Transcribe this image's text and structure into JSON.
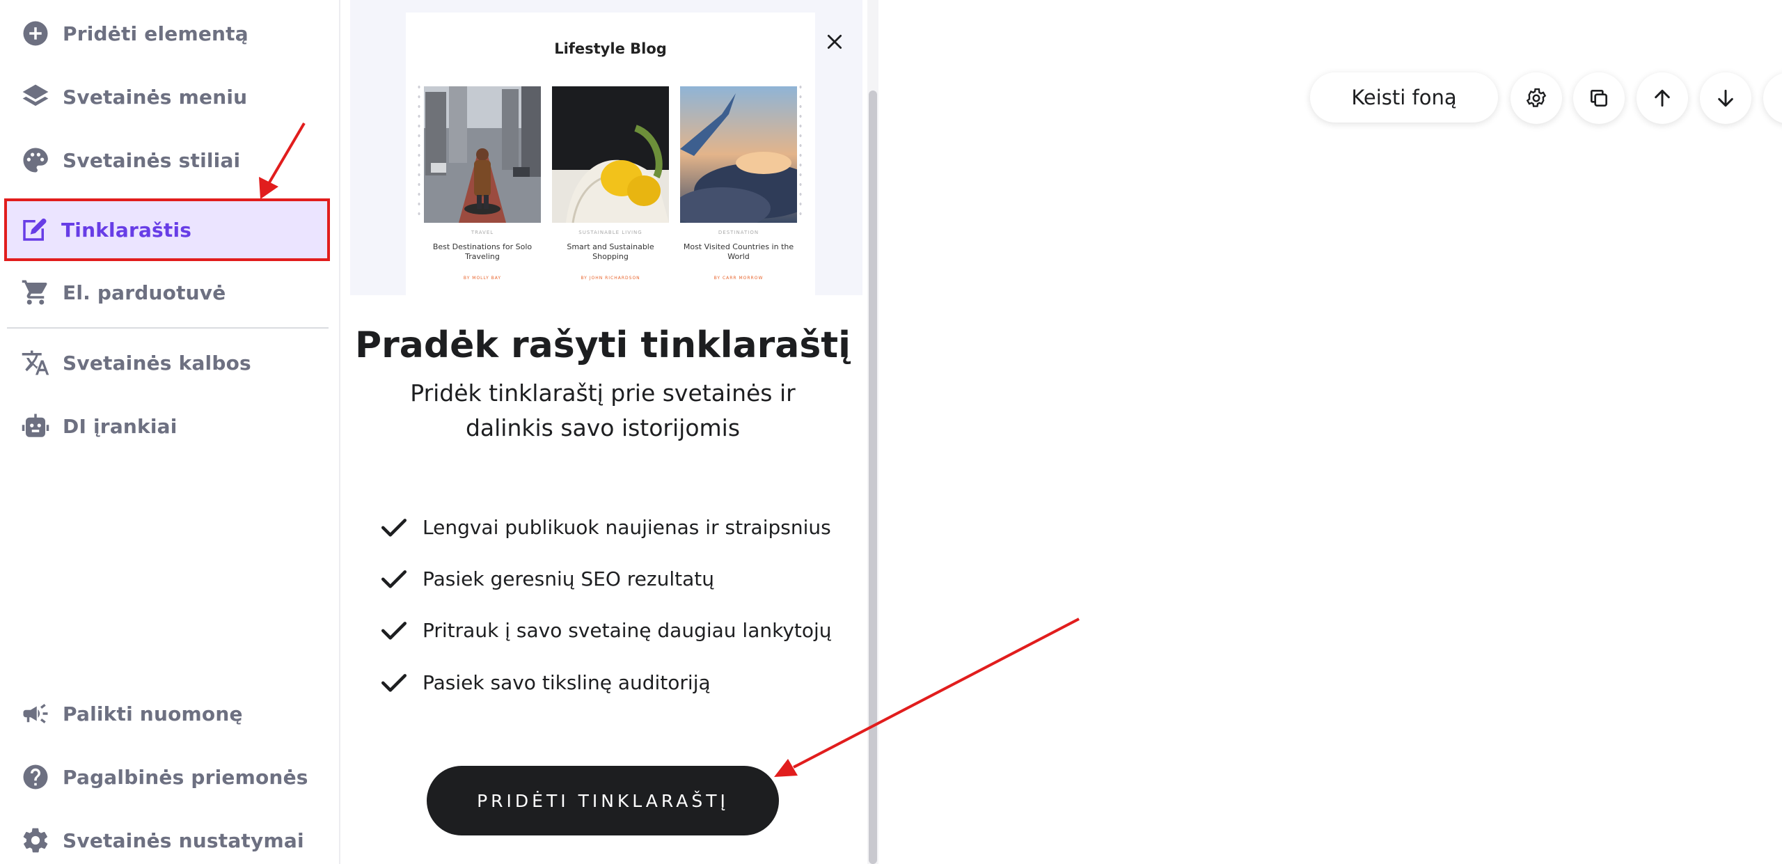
{
  "sidebar": {
    "items": [
      {
        "label": "Pridėti elementą",
        "icon": "plus-circle-icon"
      },
      {
        "label": "Svetainės meniu",
        "icon": "layers-icon"
      },
      {
        "label": "Svetainės stiliai",
        "icon": "palette-icon"
      },
      {
        "label": "Tinklaraštis",
        "icon": "edit-icon"
      },
      {
        "label": "El. parduotuvė",
        "icon": "cart-icon"
      },
      {
        "label": "Svetainės kalbos",
        "icon": "translate-icon"
      },
      {
        "label": "DI įrankiai",
        "icon": "robot-icon"
      }
    ],
    "bottom_items": [
      {
        "label": "Palikti nuomonę",
        "icon": "megaphone-icon"
      },
      {
        "label": "Pagalbinės priemonės",
        "icon": "help-icon"
      },
      {
        "label": "Svetainės nustatymai",
        "icon": "settings-icon"
      }
    ],
    "active_label": "Tinklaraštis"
  },
  "panel": {
    "preview": {
      "title": "Lifestyle Blog",
      "posts": [
        {
          "category": "TRAVEL",
          "title": "Best Destinations for Solo Traveling",
          "byline": "BY MOLLY BAY"
        },
        {
          "category": "SUSTAINABLE LIVING",
          "title": "Smart and Sustainable Shopping",
          "byline": "BY JOHN RICHARDSON"
        },
        {
          "category": "DESTINATION",
          "title": "Most Visited Countries in the World",
          "byline": "BY CARR MORROW"
        }
      ]
    },
    "heading": "Pradėk rašyti tinklaraštį",
    "subheading": "Pridėk tinklaraštį prie svetainės ir dalinkis savo istorijomis",
    "features": [
      "Lengvai publikuok naujienas ir straipsnius",
      "Pasiek geresnių SEO rezultatų",
      "Pritrauk į savo svetainę daugiau lankytojų",
      "Pasiek savo tikslinę auditoriją"
    ],
    "cta_label": "PRIDĖTI TINKLARAŠTĮ"
  },
  "toolbar": {
    "change_background_label": "Keisti foną",
    "icons": [
      "gear-icon",
      "duplicate-icon",
      "arrow-up-icon",
      "arrow-down-icon"
    ]
  },
  "colors": {
    "accent": "#673de6",
    "active_bg": "#ebe4ff",
    "annotation": "#e11d1d",
    "sidebar_text": "#6d7081",
    "dark": "#1d1e20"
  }
}
